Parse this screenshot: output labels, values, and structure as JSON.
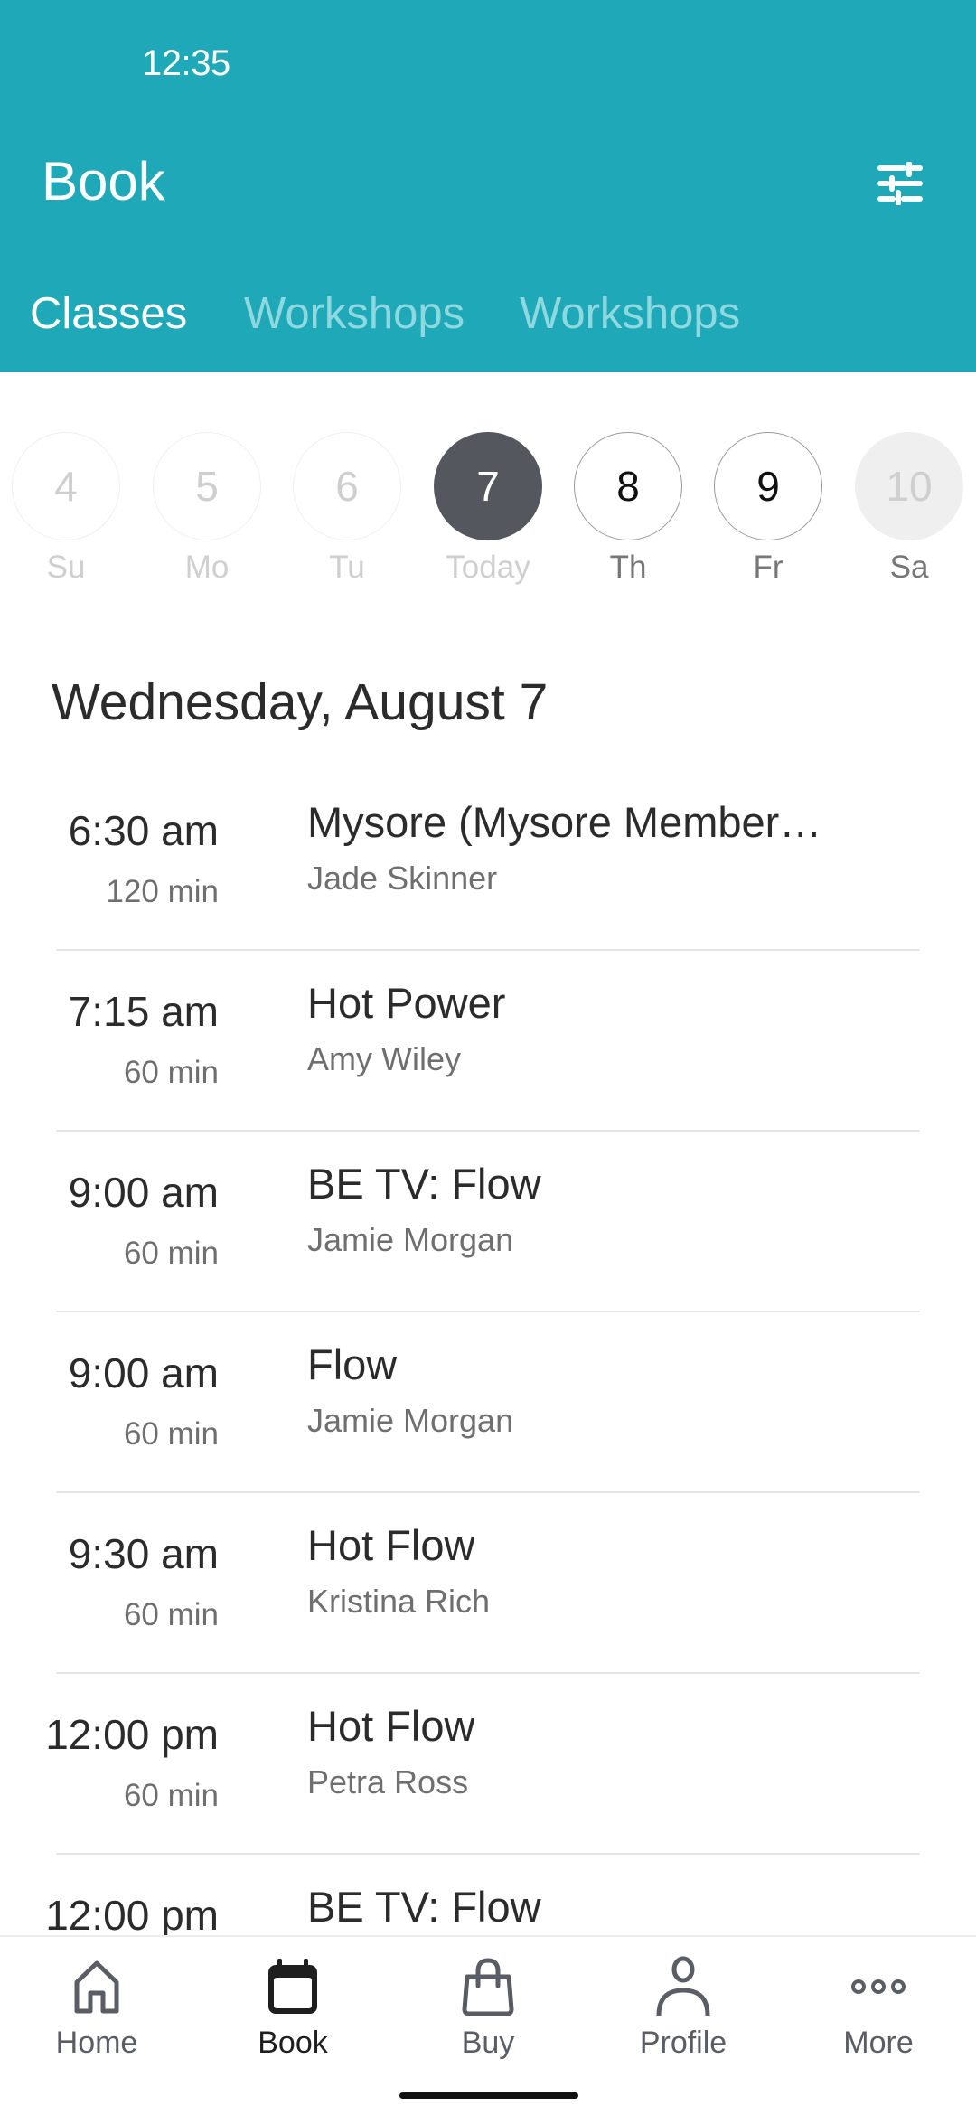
{
  "status_bar": {
    "time": "12:35"
  },
  "header": {
    "title": "Book",
    "filter_icon": "filter-sliders-icon",
    "background_color": "#1FA9B8"
  },
  "tabs": [
    {
      "label": "Classes",
      "active": true
    },
    {
      "label": "Workshops",
      "active": false
    },
    {
      "label": "Workshops",
      "active": false
    }
  ],
  "date_strip": [
    {
      "day": "4",
      "label": "Su",
      "state": "past"
    },
    {
      "day": "5",
      "label": "Mo",
      "state": "past"
    },
    {
      "day": "6",
      "label": "Tu",
      "state": "past"
    },
    {
      "day": "7",
      "label": "Today",
      "state": "selected"
    },
    {
      "day": "8",
      "label": "Th",
      "state": "future"
    },
    {
      "day": "9",
      "label": "Fr",
      "state": "future"
    },
    {
      "day": "10",
      "label": "Sa",
      "state": "unavailable"
    }
  ],
  "day_heading": "Wednesday, August 7",
  "classes": [
    {
      "time": "6:30 am",
      "duration": "120 min",
      "name": "Mysore (Mysore Member…",
      "instructor": "Jade Skinner"
    },
    {
      "time": "7:15 am",
      "duration": "60 min",
      "name": "Hot Power",
      "instructor": "Amy Wiley"
    },
    {
      "time": "9:00 am",
      "duration": "60 min",
      "name": "BE TV: Flow",
      "instructor": "Jamie Morgan"
    },
    {
      "time": "9:00 am",
      "duration": "60 min",
      "name": "Flow",
      "instructor": "Jamie Morgan"
    },
    {
      "time": "9:30 am",
      "duration": "60 min",
      "name": "Hot Flow",
      "instructor": "Kristina Rich"
    },
    {
      "time": "12:00 pm",
      "duration": "60 min",
      "name": "Hot Flow",
      "instructor": "Petra Ross"
    },
    {
      "time": "12:00 pm",
      "duration": "",
      "name": "BE TV: Flow",
      "instructor": ""
    }
  ],
  "bottom_nav": [
    {
      "label": "Home",
      "icon": "home-icon",
      "active": false
    },
    {
      "label": "Book",
      "icon": "calendar-icon",
      "active": true
    },
    {
      "label": "Buy",
      "icon": "shopping-bag-icon",
      "active": false
    },
    {
      "label": "Profile",
      "icon": "person-icon",
      "active": false
    },
    {
      "label": "More",
      "icon": "more-dots-icon",
      "active": false
    }
  ]
}
